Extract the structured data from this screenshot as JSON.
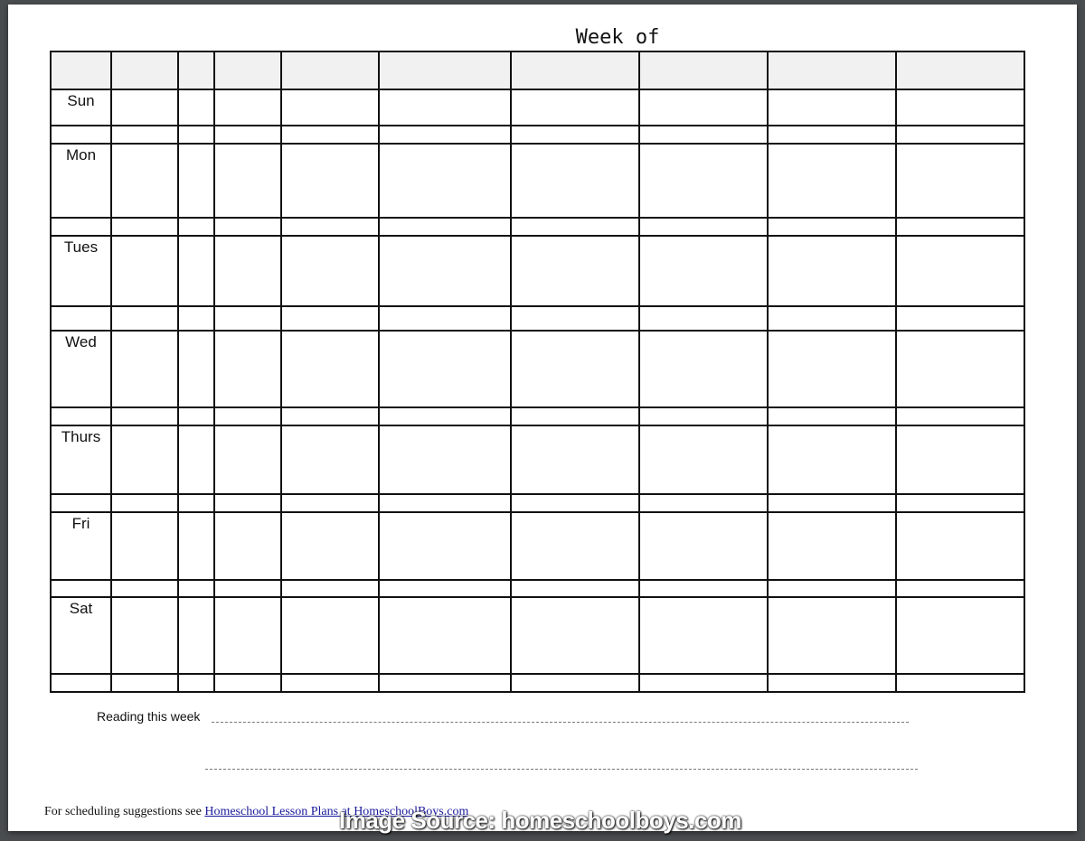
{
  "document": {
    "title": "Week of",
    "columns_count": 10,
    "days": [
      {
        "label": "Sun"
      },
      {
        "label": "Mon"
      },
      {
        "label": "Tues"
      },
      {
        "label": "Wed"
      },
      {
        "label": "Thurs"
      },
      {
        "label": "Fri"
      },
      {
        "label": "Sat"
      }
    ],
    "reading_label": "Reading this week",
    "footer_text": "For scheduling suggestions see ",
    "footer_link": "Homeschool Lesson Plans at HomeschoolBoys.com",
    "watermark": "Image Source: homeschoolboys.com"
  }
}
